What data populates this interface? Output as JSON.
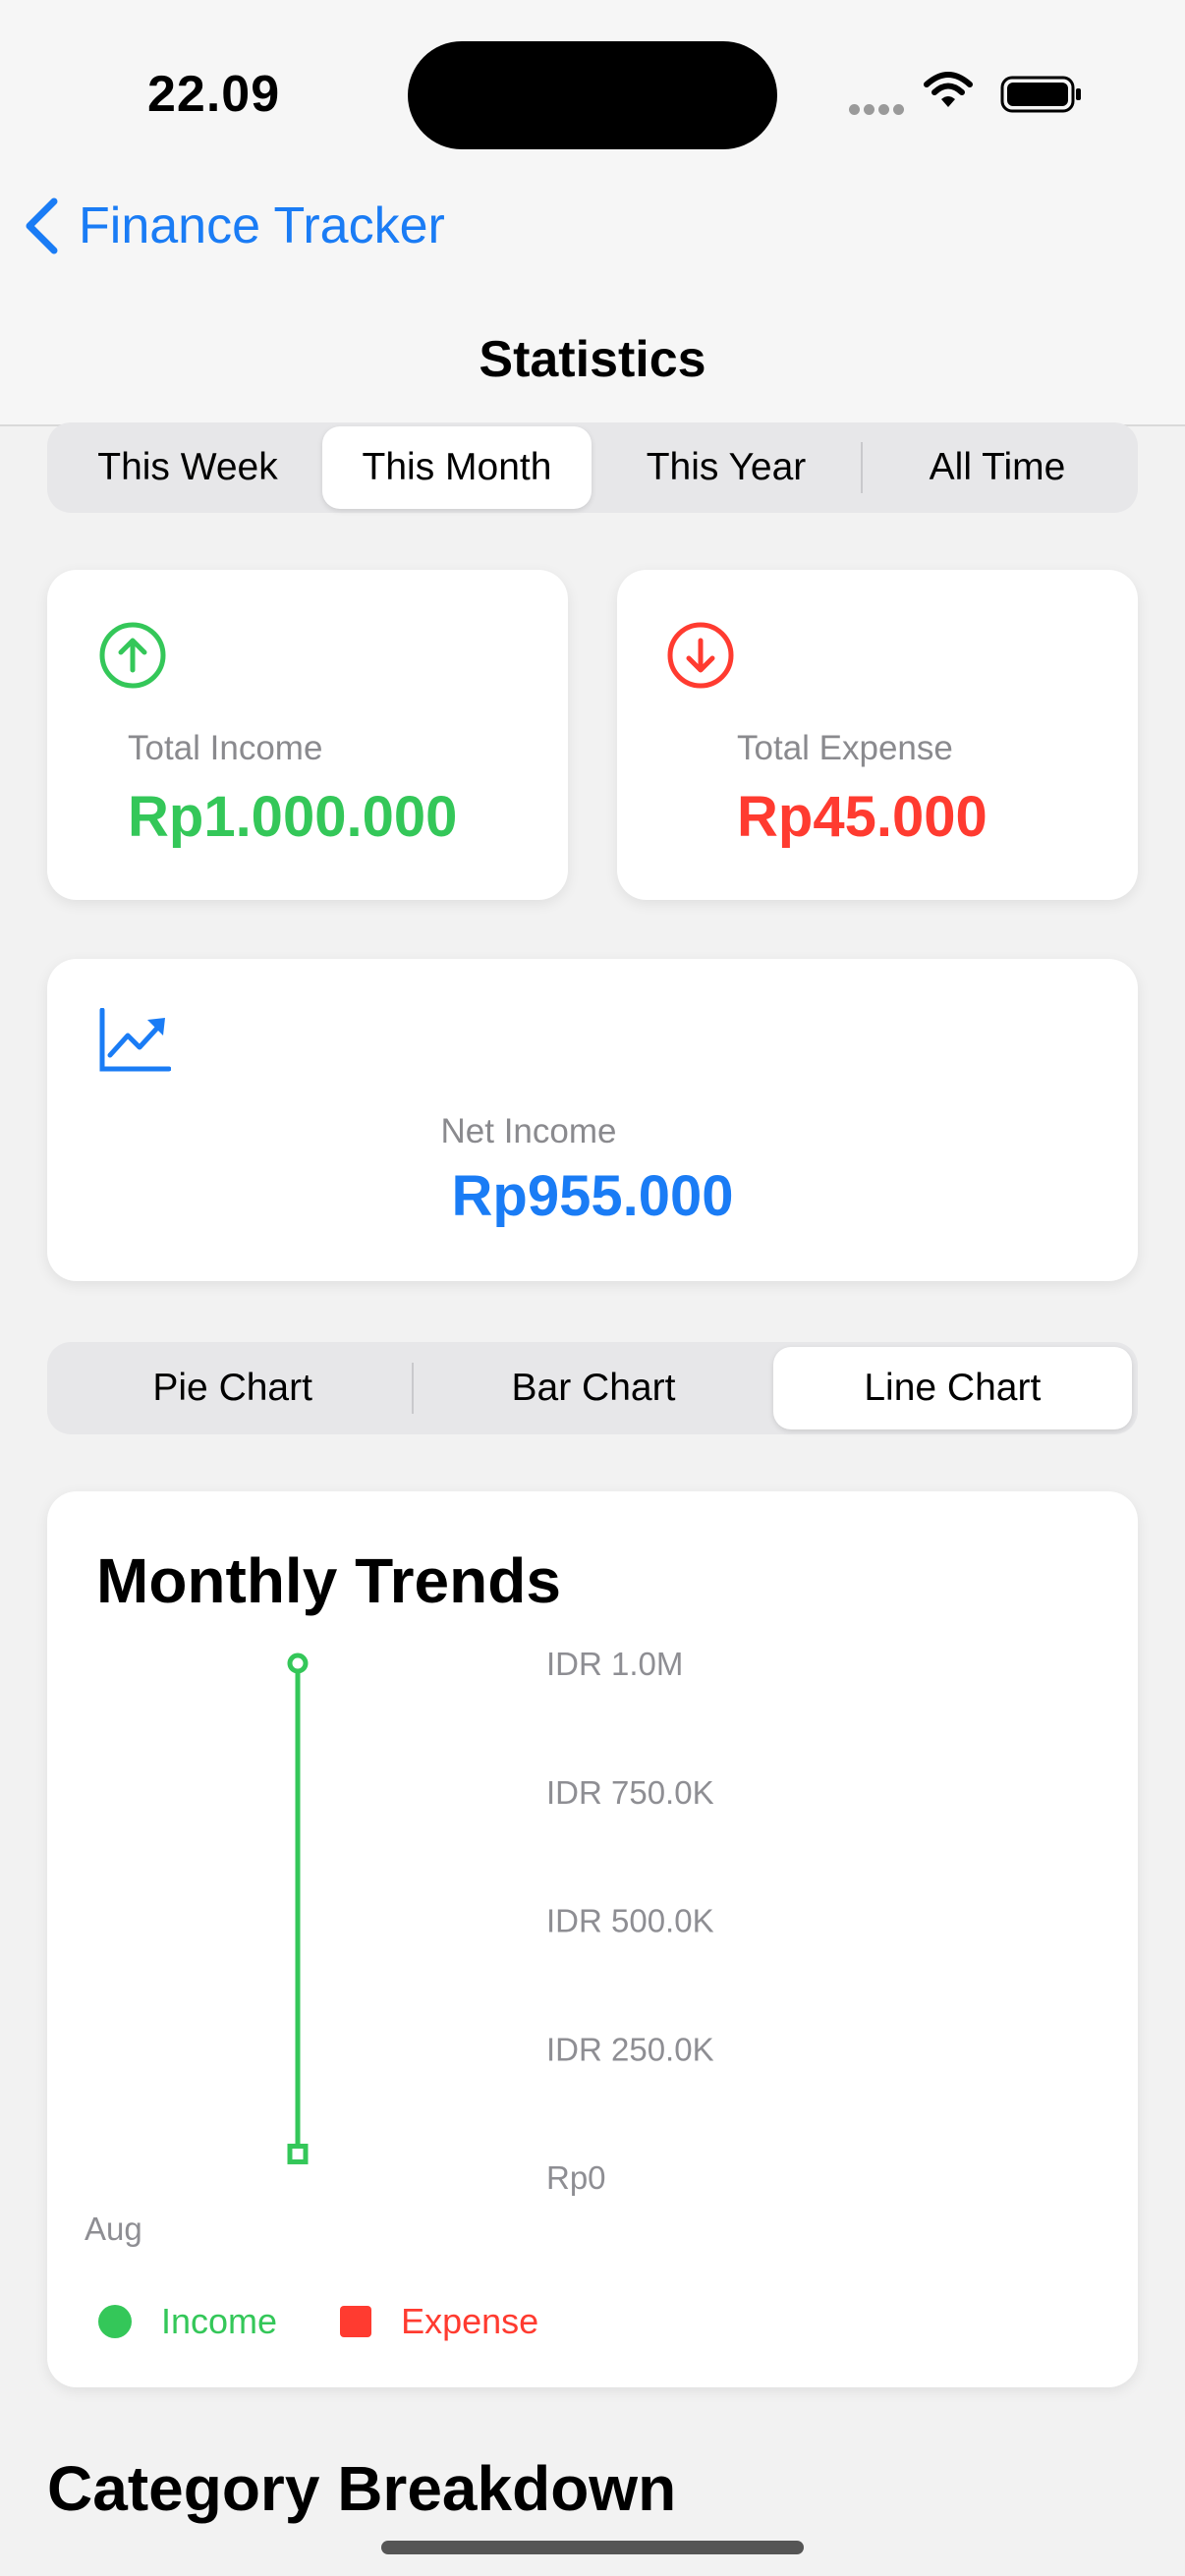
{
  "status_bar": {
    "time": "22.09"
  },
  "nav": {
    "back_label": "Finance Tracker",
    "title": "Statistics"
  },
  "period_tabs": [
    {
      "label": "This Week",
      "selected": false
    },
    {
      "label": "This Month",
      "selected": true
    },
    {
      "label": "This Year",
      "selected": false
    },
    {
      "label": "All Time",
      "selected": false
    }
  ],
  "summary": {
    "income": {
      "label": "Total Income",
      "value": "Rp1.000.000",
      "color": "#34c759",
      "icon": "arrow-up-circle-icon"
    },
    "expense": {
      "label": "Total Expense",
      "value": "Rp45.000",
      "color": "#ff3b30",
      "icon": "arrow-down-circle-icon"
    },
    "net": {
      "label": "Net Income",
      "value": "Rp955.000",
      "color": "#1a7cf5",
      "icon": "trend-up-chart-icon"
    }
  },
  "chart_tabs": [
    {
      "label": "Pie Chart",
      "selected": false
    },
    {
      "label": "Bar Chart",
      "selected": false
    },
    {
      "label": "Line Chart",
      "selected": true
    }
  ],
  "chart_card": {
    "title": "Monthly Trends"
  },
  "chart_data": {
    "type": "line",
    "title": "Monthly Trends",
    "categories": [
      "Aug"
    ],
    "y_tick_labels": [
      "IDR 1.0M",
      "IDR 750.0K",
      "IDR 500.0K",
      "IDR 250.0K",
      "Rp0"
    ],
    "ylim": [
      0,
      1000000
    ],
    "series": [
      {
        "name": "Income",
        "color": "#34c759",
        "values": [
          1000000
        ],
        "marker": "circle"
      },
      {
        "name": "Expense",
        "color": "#ff3b30",
        "values": [
          45000
        ],
        "marker": "square"
      }
    ],
    "legend_position": "bottom-left"
  },
  "section": {
    "title": "Category Breakdown"
  }
}
